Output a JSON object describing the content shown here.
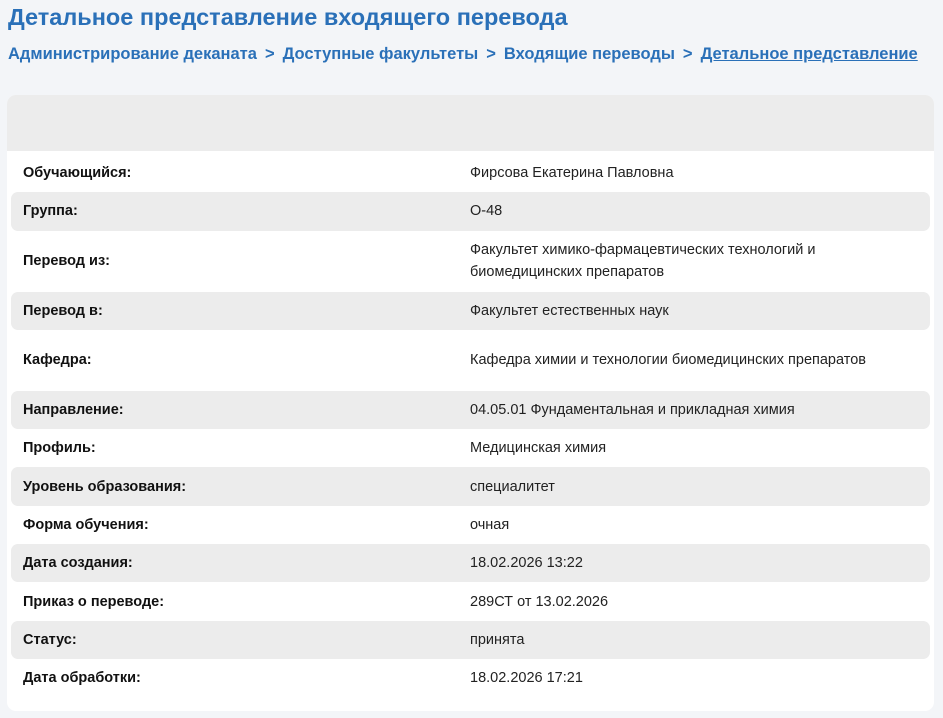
{
  "page": {
    "title": "Детальное представление входящего перевода"
  },
  "breadcrumb": {
    "separator": ">",
    "items": [
      {
        "label": "Администрирование деканата"
      },
      {
        "label": "Доступные факультеты"
      },
      {
        "label": "Входящие переводы"
      },
      {
        "label": "Детальное представление"
      }
    ]
  },
  "details": [
    {
      "label": "Обучающийся:",
      "value": "Фирсова Екатерина Павловна"
    },
    {
      "label": "Группа:",
      "value": "О-48"
    },
    {
      "label": "Перевод из:",
      "value": "Факультет химико-фармацевтических технологий и биомедицинских препаратов"
    },
    {
      "label": "Перевод в:",
      "value": "Факультет естественных наук"
    },
    {
      "label": "Кафедра:",
      "value": "Кафедра химии и технологии биомедицинских препаратов"
    },
    {
      "label": "Направление:",
      "value": "04.05.01 Фундаментальная и прикладная химия"
    },
    {
      "label": "Профиль:",
      "value": "Медицинская химия"
    },
    {
      "label": "Уровень образования:",
      "value": "специалитет"
    },
    {
      "label": "Форма обучения:",
      "value": "очная"
    },
    {
      "label": "Дата создания:",
      "value": "18.02.2026 13:22"
    },
    {
      "label": "Приказ о переводе:",
      "value": "289СТ от 13.02.2026"
    },
    {
      "label": "Статус:",
      "value": "принята"
    },
    {
      "label": "Дата обработки:",
      "value": "18.02.2026 17:21"
    }
  ],
  "colors": {
    "accent": "#2a70b8",
    "row_alt": "#ececec",
    "background": "#f3f5f8"
  }
}
